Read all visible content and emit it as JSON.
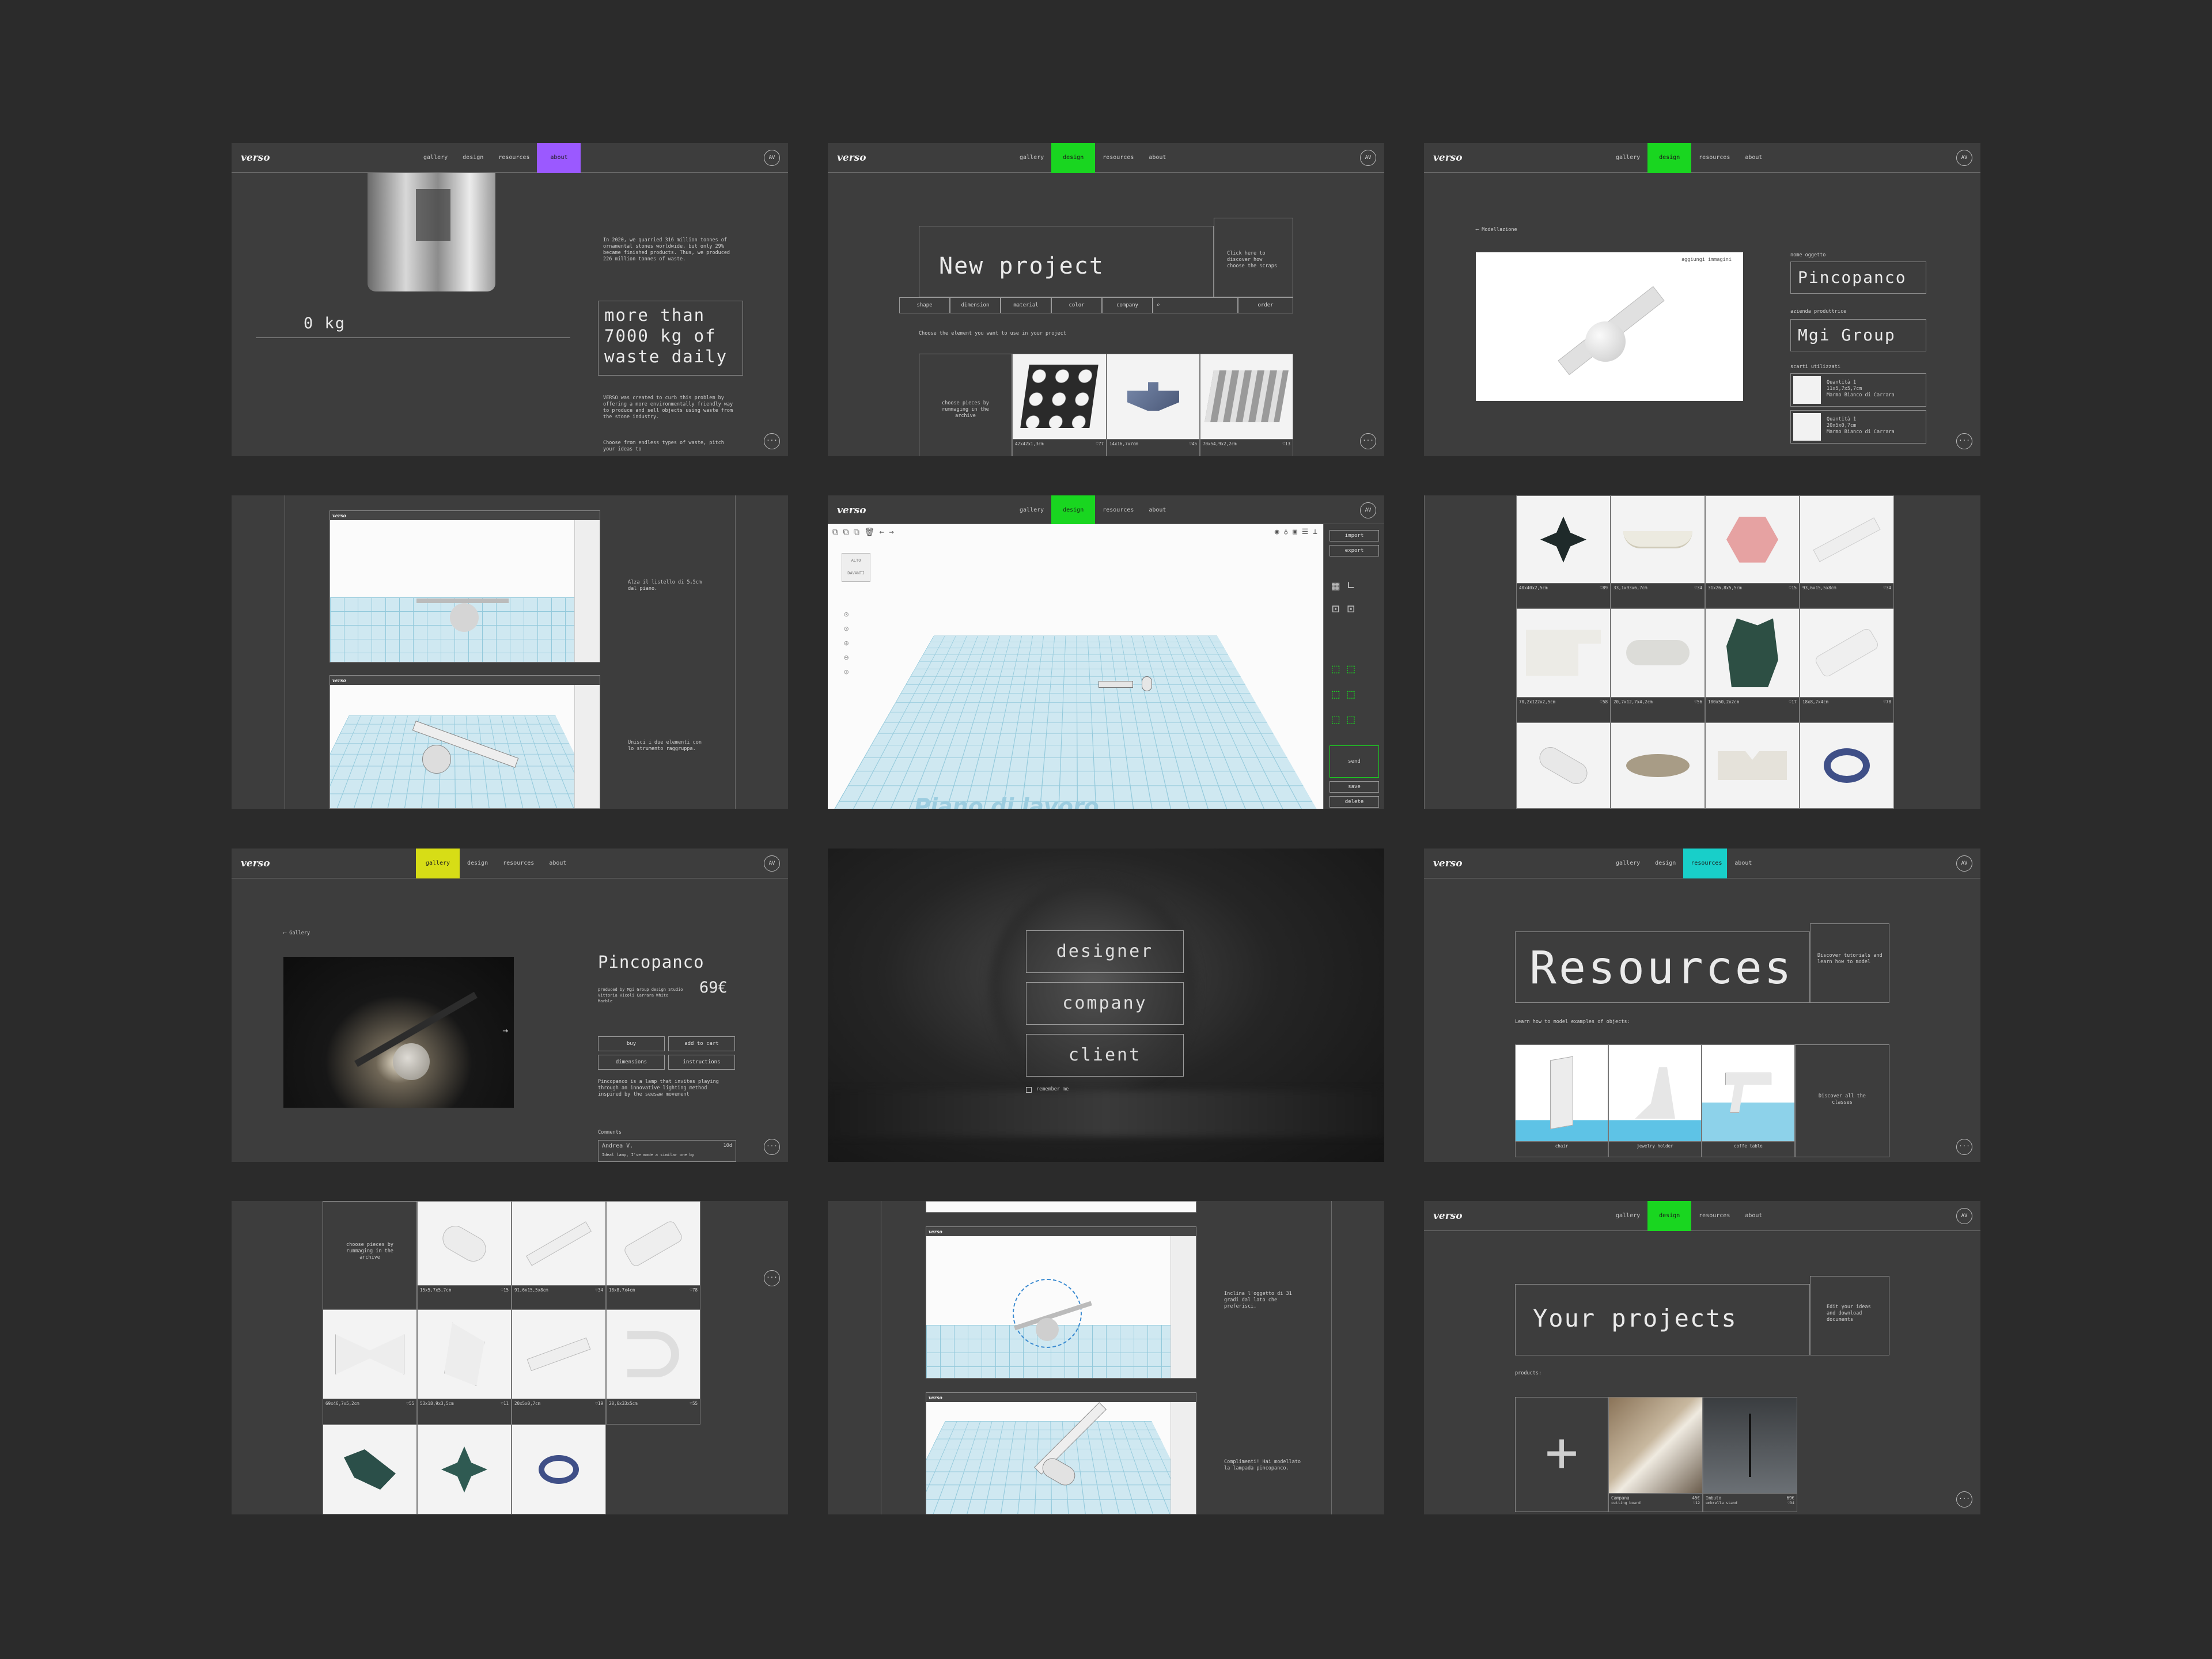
{
  "colors": {
    "background": "#2b2b2b",
    "screen": "#3d3d3d",
    "about": "#9b59ff",
    "design": "#19d620",
    "gallery": "#d7dd16",
    "resources": "#18cfc9"
  },
  "brand": "verso",
  "avatar": "AV",
  "more_icon": "···",
  "nav": {
    "gallery": "gallery",
    "design": "design",
    "resources": "resources",
    "about": "about"
  },
  "about": {
    "weight": "0 kg",
    "intro": "In 2020, we quarried 316 million tonnes of ornamental stones worldwide, but only 29% became finished products. Thus, we produced 226 million tonnes of waste.",
    "headline": "more than 7000 kg of waste daily",
    "mission": "VERSO was created to curb this problem by offering a more environmentally friendly way to produce and sell objects using waste from the stone industry.",
    "choose": "Choose from endless types of waste, pitch your ideas to"
  },
  "new_project": {
    "title": "New project",
    "hint": "Click here to discover how choose the scraps",
    "filters": [
      "shape",
      "dimension",
      "material",
      "color",
      "company"
    ],
    "order": "order",
    "choose_text": "Choose the element you want to use in your project",
    "archive": "choose pieces by rummaging in the archive",
    "items": [
      {
        "size": "42x42x1,3cm",
        "likes": "♡77"
      },
      {
        "size": "14x16,7x7cm",
        "likes": "♡45"
      },
      {
        "size": "70x54,9x2,2cm",
        "likes": "♡13"
      }
    ]
  },
  "modeling": {
    "back": "Modellazione",
    "add_images": "aggiungi immagini",
    "name_label": "nome oggetto",
    "name": "Pincopanco",
    "company_label": "azienda produttrice",
    "company": "Mgi Group",
    "scraps_label": "scarti utilizzati",
    "scraps": [
      {
        "qty": "Quantità 1",
        "size": "11x5,7x5,7cm",
        "material": "Marmo Bianco di Carrara"
      },
      {
        "qty": "Quantità 1",
        "size": "20x5x0,7cm",
        "material": "Marmo Bianco di Carrara"
      }
    ]
  },
  "tutorial_1": {
    "step1": "Alza il listello di 5,5cm dal piano.",
    "step2": "Unisci i due elementi con lo strumento raggruppa."
  },
  "editor": {
    "import": "import",
    "export": "export",
    "send": "send",
    "save": "save",
    "delete": "delete",
    "cube_top": "ALTO",
    "cube_front": "DAVANTI",
    "workplane": "Piano di lavoro"
  },
  "archive_grid": [
    {
      "size": "40x40x2,5cm",
      "likes": "♡89",
      "avail": "10 pcs available"
    },
    {
      "size": "33,1x93x6,7cm",
      "likes": "♡34",
      "avail": "19 pcs available"
    },
    {
      "size": "31x26,8x5,5cm",
      "likes": "♡15",
      "avail": "1 pcs available"
    },
    {
      "size": "93,6x15,5x8cm",
      "likes": "♡34",
      "avail": "5 pcs available"
    },
    {
      "size": "70,2x122x2,5cm",
      "likes": "♡58",
      "avail": "1 pcs available"
    },
    {
      "size": "20,7x12,7x4,2cm",
      "likes": "♡56",
      "avail": "33 pcs available"
    },
    {
      "size": "100x50,2x2cm",
      "likes": "♡17",
      "avail": "1 pcs available"
    },
    {
      "size": "18x8,7x4cm",
      "likes": "♡78",
      "avail": "40 pcs available"
    }
  ],
  "product": {
    "back": "Gallery",
    "name": "Pincopanco",
    "price": "69€",
    "meta": "produced by Mgi Group design Studio Vittoria Vicoli Carrara White Marble",
    "buy": "buy",
    "cart": "add to cart",
    "dimensions": "dimensions",
    "instructions": "instructions",
    "desc": "Pincopanco is a lamp that invites playing through an innovative lighting method inspired by the seesaw movement",
    "comments": "Comments",
    "comment_author": "Andrea V.",
    "comment_text": "Ideal lamp, I've made a similar one by",
    "comment_date": "10d"
  },
  "roles": {
    "designer": "designer",
    "company": "company",
    "client": "client",
    "remember": "remember me"
  },
  "resources": {
    "title": "Resources",
    "hint": "Discover tutorials and learn how to model",
    "learn": "Learn how to model examples of objects:",
    "items": [
      "chair",
      "jewelry holder",
      "coffe table"
    ],
    "all": "Discover all the classes"
  },
  "archive_detail": {
    "archive": "choose pieces by rummaging in the archive",
    "items": [
      {
        "size": "15x5,7x5,7cm",
        "likes": "♡15",
        "avail": "2 pcs available"
      },
      {
        "size": "91,6x15,5x8cm",
        "likes": "♡34",
        "avail": "5 pcs available"
      },
      {
        "size": "18x8,7x4cm",
        "likes": "♡78",
        "avail": "10 pcs available"
      },
      {
        "size": "69x46,7x5,2cm",
        "likes": "♡55",
        "avail": "2 pcs available"
      },
      {
        "size": "53x18,9x3,5cm",
        "likes": "♡11",
        "avail": "15 pcs available"
      },
      {
        "size": "20x5x0,7cm",
        "likes": "♡19",
        "avail": "4 pcs available"
      },
      {
        "size": "20,6x33x5cm",
        "likes": "♡55",
        "avail": "12 pcs available"
      }
    ]
  },
  "tutorial_2": {
    "step1": "Inclina l'oggetto di 31 gradi dal lato che preferisci.",
    "step2": "Complimenti! Hai modellato la lampada pincopanco."
  },
  "projects": {
    "title": "Your projects",
    "hint": "Edit your ideas and download documents",
    "products_label": "products:",
    "add": "+",
    "items": [
      {
        "name": "Campana",
        "sub": "cutting board",
        "price": "45€",
        "likes": "♡12"
      },
      {
        "name": "Imbuto",
        "sub": "umbrella stand",
        "price": "69€",
        "likes": "♡34"
      }
    ]
  }
}
